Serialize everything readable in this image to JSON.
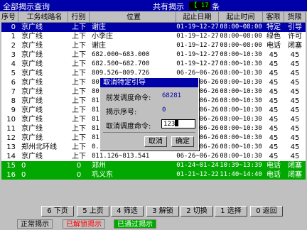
{
  "title": {
    "left": "全部揭示查询",
    "count_label": "共有揭示",
    "count_value": "【 17 】",
    "count_unit": "条"
  },
  "columns": {
    "no": "序号",
    "line": "工务线路名",
    "dir": "行别",
    "pos": "位置",
    "date": "起止日期",
    "time": "起止时间",
    "pass": "客限",
    "frt": "货限"
  },
  "rows": [
    {
      "no": "0",
      "line": "京广线",
      "dir": "上下",
      "pos": "谢庄",
      "date": "01-19~12-27",
      "time": "08:00~08:00",
      "pass": "特定",
      "frt": "引导",
      "style": "sel"
    },
    {
      "no": "1",
      "line": "京广线",
      "dir": "上下",
      "pos": "小李庄",
      "date": "01-19~12-27",
      "time": "08:00~08:00",
      "pass": "绿色",
      "frt": "许可",
      "style": "white"
    },
    {
      "no": "2",
      "line": "京广线",
      "dir": "上下",
      "pos": "谢庄",
      "date": "01-19~12-27",
      "time": "08:00~08:00",
      "pass": "电话",
      "frt": "闭塞",
      "style": "white"
    },
    {
      "no": "3",
      "line": "京广线",
      "dir": "上下",
      "pos": "682.000~683.000",
      "date": "01-19~12-27",
      "time": "08:00~10:30",
      "pass": "45",
      "frt": "45",
      "style": "white"
    },
    {
      "no": "4",
      "line": "京广线",
      "dir": "上下",
      "pos": "682.500~682.700",
      "date": "01-19~12-27",
      "time": "08:00~10:30",
      "pass": "45",
      "frt": "45",
      "style": "white"
    },
    {
      "no": "5",
      "line": "京广线",
      "dir": "上下",
      "pos": "809.526~809.726",
      "date": "06-26~06-26",
      "time": "08:00~10:30",
      "pass": "45",
      "frt": "45",
      "style": "white"
    },
    {
      "no": "6",
      "line": "京广线",
      "dir": "上下",
      "pos": "809",
      "date": "06-26~06-26",
      "time": "08:00~10:30",
      "pass": "45",
      "frt": "45",
      "style": "white"
    },
    {
      "no": "7",
      "line": "京广线",
      "dir": "上下",
      "pos": "809",
      "date": "06-26~06-26",
      "time": "08:00~10:30",
      "pass": "45",
      "frt": "45",
      "style": "white"
    },
    {
      "no": "8",
      "line": "京广线",
      "dir": "上下",
      "pos": "810",
      "date": "06-26~06-26",
      "time": "08:00~10:30",
      "pass": "45",
      "frt": "45",
      "style": "white"
    },
    {
      "no": "9",
      "line": "京广线",
      "dir": "上下",
      "pos": "810",
      "date": "06-26~06-26",
      "time": "08:00~10:30",
      "pass": "45",
      "frt": "45",
      "style": "white"
    },
    {
      "no": "10",
      "line": "京广线",
      "dir": "上下",
      "pos": "810",
      "date": "06-26~06-26",
      "time": "08:00~10:30",
      "pass": "45",
      "frt": "45",
      "style": "white"
    },
    {
      "no": "11",
      "line": "京广线",
      "dir": "上下",
      "pos": "810",
      "date": "06-26~06-26",
      "time": "08:00~10:30",
      "pass": "45",
      "frt": "45",
      "style": "white"
    },
    {
      "no": "12",
      "line": "京广线",
      "dir": "上下",
      "pos": "810",
      "date": "06-26~06-26",
      "time": "08:00~10:30",
      "pass": "45",
      "frt": "45",
      "style": "white"
    },
    {
      "no": "13",
      "line": "郑州北环线",
      "dir": "上下",
      "pos": "0.0",
      "date": "06-26~06-26",
      "time": "08:00~10:30",
      "pass": "45",
      "frt": "45",
      "style": "white"
    },
    {
      "no": "14",
      "line": "京广线",
      "dir": "上下",
      "pos": "811.126~813.541",
      "date": "06-26~06-26",
      "time": "08:00~10:30",
      "pass": "45",
      "frt": "45",
      "style": "white"
    },
    {
      "no": "15",
      "line": "0",
      "dir": "0",
      "pos": "郑州",
      "date": "01-24~01-24",
      "time": "10:39~13:39",
      "pass": "电话",
      "frt": "闭塞",
      "style": "green"
    },
    {
      "no": "16",
      "line": "0",
      "dir": "0",
      "pos": "巩义东",
      "date": "01-21~12-22",
      "time": "11:40~14:40",
      "pass": "电话",
      "frt": "闭塞",
      "style": "green"
    }
  ],
  "dialog": {
    "title": "取消特定引导",
    "prev_cmd_label": "前发调度命令:",
    "prev_cmd_value": "68281",
    "seq_label": "揭示序号:",
    "seq_value": "0",
    "cancel_cmd_label": "取消调度命令:",
    "cancel_cmd_value": "123",
    "cancel_button": "取消",
    "confirm_button": "确定"
  },
  "fkeys": [
    {
      "key": "6",
      "label": "下页"
    },
    {
      "key": "5",
      "label": "上页"
    },
    {
      "key": "4",
      "label": "筛选"
    },
    {
      "key": "3",
      "label": "解锁"
    },
    {
      "key": "2",
      "label": "切换"
    },
    {
      "key": "1",
      "label": "选择"
    },
    {
      "key": "0",
      "label": "返回"
    }
  ],
  "legend": {
    "normal": "正常揭示",
    "unlocked": "已解锁揭示",
    "passed": "已通过揭示"
  },
  "colors": {
    "title_bg": "#0000a8",
    "selected_row": "#0000a8",
    "green_row": "#00a800",
    "count_value": "#00ff00",
    "unlocked_text": "#ff0000"
  }
}
